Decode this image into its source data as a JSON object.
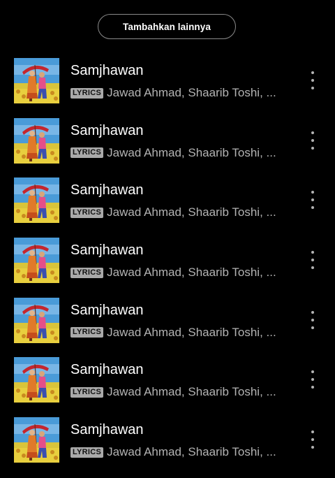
{
  "header": {
    "add_more_label": "Tambahkan lainnya"
  },
  "colors": {
    "background": "#000000",
    "primary_text": "#ffffff",
    "secondary_text": "#b3b3b3",
    "badge_background": "#a9a9a9"
  },
  "tracks": [
    {
      "title": "Samjhawan",
      "badge": "LYRICS",
      "artists": "Jawad Ahmad, Shaarib Toshi, ...",
      "cover_icon": "album-art",
      "menu_icon": "more-vertical-icon"
    },
    {
      "title": "Samjhawan",
      "badge": "LYRICS",
      "artists": "Jawad Ahmad, Shaarib Toshi, ...",
      "cover_icon": "album-art",
      "menu_icon": "more-vertical-icon"
    },
    {
      "title": "Samjhawan",
      "badge": "LYRICS",
      "artists": "Jawad Ahmad, Shaarib Toshi, ...",
      "cover_icon": "album-art",
      "menu_icon": "more-vertical-icon"
    },
    {
      "title": "Samjhawan",
      "badge": "LYRICS",
      "artists": "Jawad Ahmad, Shaarib Toshi, ...",
      "cover_icon": "album-art",
      "menu_icon": "more-vertical-icon"
    },
    {
      "title": "Samjhawan",
      "badge": "LYRICS",
      "artists": "Jawad Ahmad, Shaarib Toshi, ...",
      "cover_icon": "album-art",
      "menu_icon": "more-vertical-icon"
    },
    {
      "title": "Samjhawan",
      "badge": "LYRICS",
      "artists": "Jawad Ahmad, Shaarib Toshi, ...",
      "cover_icon": "album-art",
      "menu_icon": "more-vertical-icon"
    },
    {
      "title": "Samjhawan",
      "badge": "LYRICS",
      "artists": "Jawad Ahmad, Shaarib Toshi, ...",
      "cover_icon": "album-art",
      "menu_icon": "more-vertical-icon"
    }
  ]
}
